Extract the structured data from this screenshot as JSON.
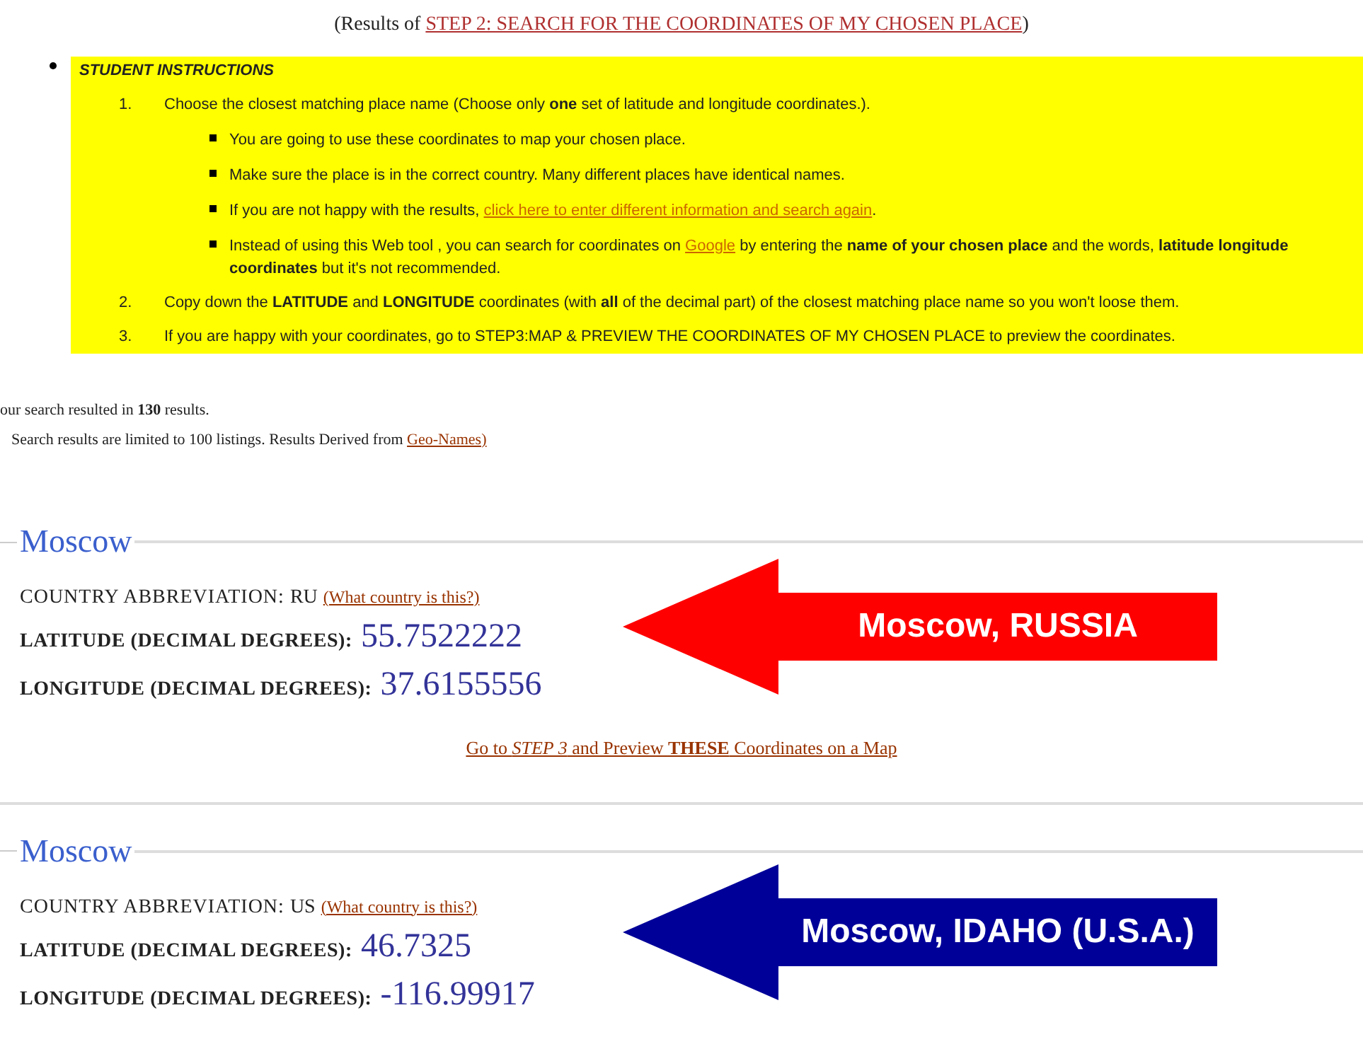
{
  "header": {
    "prefix": "(Results of ",
    "link": "STEP 2: SEARCH FOR THE COORDINATES OF MY CHOSEN PLACE",
    "suffix": ")"
  },
  "instructions": {
    "title": "STUDENT INSTRUCTIONS",
    "steps": [
      {
        "number": "1.",
        "text": "Choose the closest matching place name (Choose only **one** set of latitude and longitude coordinates.).",
        "subitems": [
          {
            "before": "You are going to use these coordinates to map your chosen place."
          },
          {
            "before": "Make sure the place is in the correct country. Many different places have identical names."
          },
          {
            "before": "If you are not happy with the results, ",
            "link": "click here to enter different information and search again",
            "after": "."
          },
          {
            "before": "Instead of using this Web tool , you can search for coordinates on ",
            "link": "Google",
            "after": " by entering the **name of your chosen place** and the words, **latitude longitude coordinates** but it's not recommended."
          }
        ]
      },
      {
        "number": "2.",
        "text": "Copy down the **LATITUDE** and **LONGITUDE** coordinates (with **all** of the decimal part) of the closest matching place name so you won't loose them."
      },
      {
        "number": "3.",
        "text": "If you are happy with your coordinates, go to STEP3:MAP & PREVIEW THE COORDINATES OF MY CHOSEN PLACE to preview the coordinates."
      }
    ]
  },
  "summary": {
    "count_text": "our search resulted in **130** results.",
    "limit_text": "Search results are limited to 100 listings. Results Derived from ",
    "source_link": "Geo-Names)"
  },
  "results": [
    {
      "name": "Moscow",
      "country_label": "COUNTRY ABBREVIATION:",
      "country": "RU",
      "country_link": "(What country is this?)",
      "lat_label": "LATITUDE (DECIMAL DEGREES):",
      "lat": "55.7522222",
      "lon_label": "LONGITUDE (DECIMAL DEGREES):",
      "lon": "37.6155556",
      "step_link": "Go to *STEP 3* and Preview **THESE** Coordinates on a Map",
      "callout": {
        "text": "Moscow, RUSSIA",
        "color": "#ff0000"
      }
    },
    {
      "name": "Moscow",
      "country_label": "COUNTRY ABBREVIATION:",
      "country": "US",
      "country_link": "(What country is this?)",
      "lat_label": "LATITUDE (DECIMAL DEGREES):",
      "lat": "46.7325",
      "lon_label": "LONGITUDE (DECIMAL DEGREES):",
      "lon": "-116.99917",
      "callout": {
        "text": "Moscow, IDAHO (U.S.A.)",
        "color": "#000099"
      }
    }
  ]
}
